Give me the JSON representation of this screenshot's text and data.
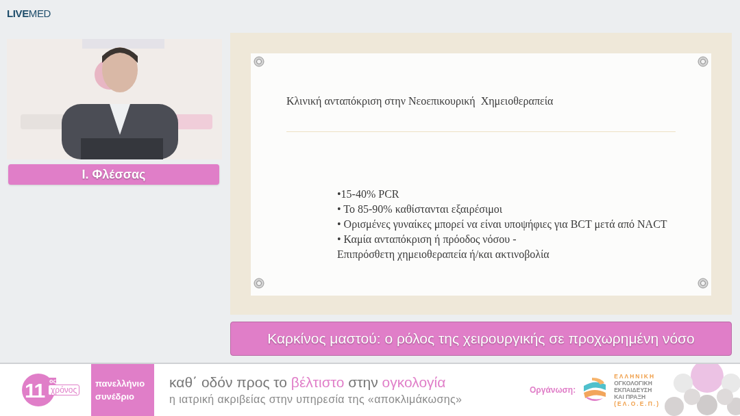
{
  "brand": {
    "bold": "LIVE",
    "light": "MED"
  },
  "speaker": {
    "name": "Ι. Φλέσσας"
  },
  "slide": {
    "title": "Κλινική ανταπόκριση στην Νεοεπικουρική  Χημειοθεραπεία",
    "lines": [
      "•15-40% PCR",
      "• Το 85-90% καθίστανται εξαιρέσιμοι",
      "• Ορισμένες γυναίκες μπορεί να είναι υποψήφιες για BCT μετά από NACT",
      "• Καμία ανταπόκριση ή πρόοδος νόσου -",
      "Επιπρόσθετη χημειοθεραπεία ή/και ακτινοβολία"
    ]
  },
  "session_title": "Καρκίνος μαστού: ο ρόλος της χειρουργικής σε προχωρημένη νόσο",
  "banner": {
    "edition_number": "11",
    "edition_suffix": "ος",
    "edition_word": "χρόνος",
    "event_lines": [
      "πανελλήνιο",
      "συνέδριο"
    ],
    "tagline": [
      {
        "text": "καθ΄ οδόν προς το ",
        "accent": false
      },
      {
        "text": "βέλτιστο",
        "accent": true
      },
      {
        "text": " στην ",
        "accent": false
      },
      {
        "text": "ογκολογία",
        "accent": true
      }
    ],
    "subtitle": "η ιατρική ακριβείας στην υπηρεσία της «αποκλιμάκωσης»",
    "organizer_label": "Οργάνωση:",
    "organizer_lines": [
      {
        "text": "ΕΛΛΗΝΙΚΗ",
        "kind": "accent"
      },
      {
        "text": "ΟΓΚΟΛΟΓΙΚΗ",
        "kind": "plain"
      },
      {
        "text": "ΕΚΠΑΙΔΕΥΣΗ",
        "kind": "plain"
      },
      {
        "text": "ΚΑΙ ΠΡΑΞΗ",
        "kind": "plain"
      },
      {
        "text": "(ΕΛ.Ο.Ε.Π.)",
        "kind": "accent"
      }
    ]
  }
}
